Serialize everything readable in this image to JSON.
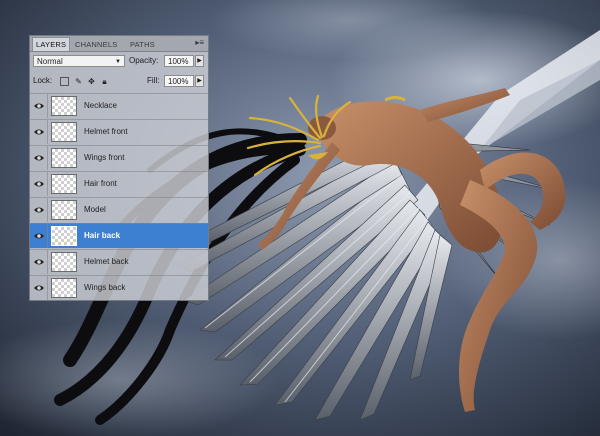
{
  "panel": {
    "tabs": [
      "LAYERS",
      "CHANNELS",
      "PATHS"
    ],
    "menu_icon": "panel-menu-icon",
    "blend_mode": "Normal",
    "opacity_label": "Opacity:",
    "opacity_value": "100%",
    "lock_label": "Lock:",
    "fill_label": "Fill:",
    "fill_value": "100%",
    "layers": [
      {
        "name": "Necklace",
        "selected": false
      },
      {
        "name": "Helmet front",
        "selected": false
      },
      {
        "name": "Wings front",
        "selected": false
      },
      {
        "name": "Hair front",
        "selected": false
      },
      {
        "name": "Model",
        "selected": false
      },
      {
        "name": "Hair back",
        "selected": true
      },
      {
        "name": "Helmet back",
        "selected": false
      },
      {
        "name": "Wings back",
        "selected": false
      }
    ]
  },
  "colors": {
    "selection": "#3d7fd1",
    "panel_bg": "#cdd0d6"
  },
  "icons": [
    "eye-icon",
    "transparency-lock-icon",
    "brush-lock-icon",
    "move-lock-icon",
    "padlock-icon"
  ]
}
